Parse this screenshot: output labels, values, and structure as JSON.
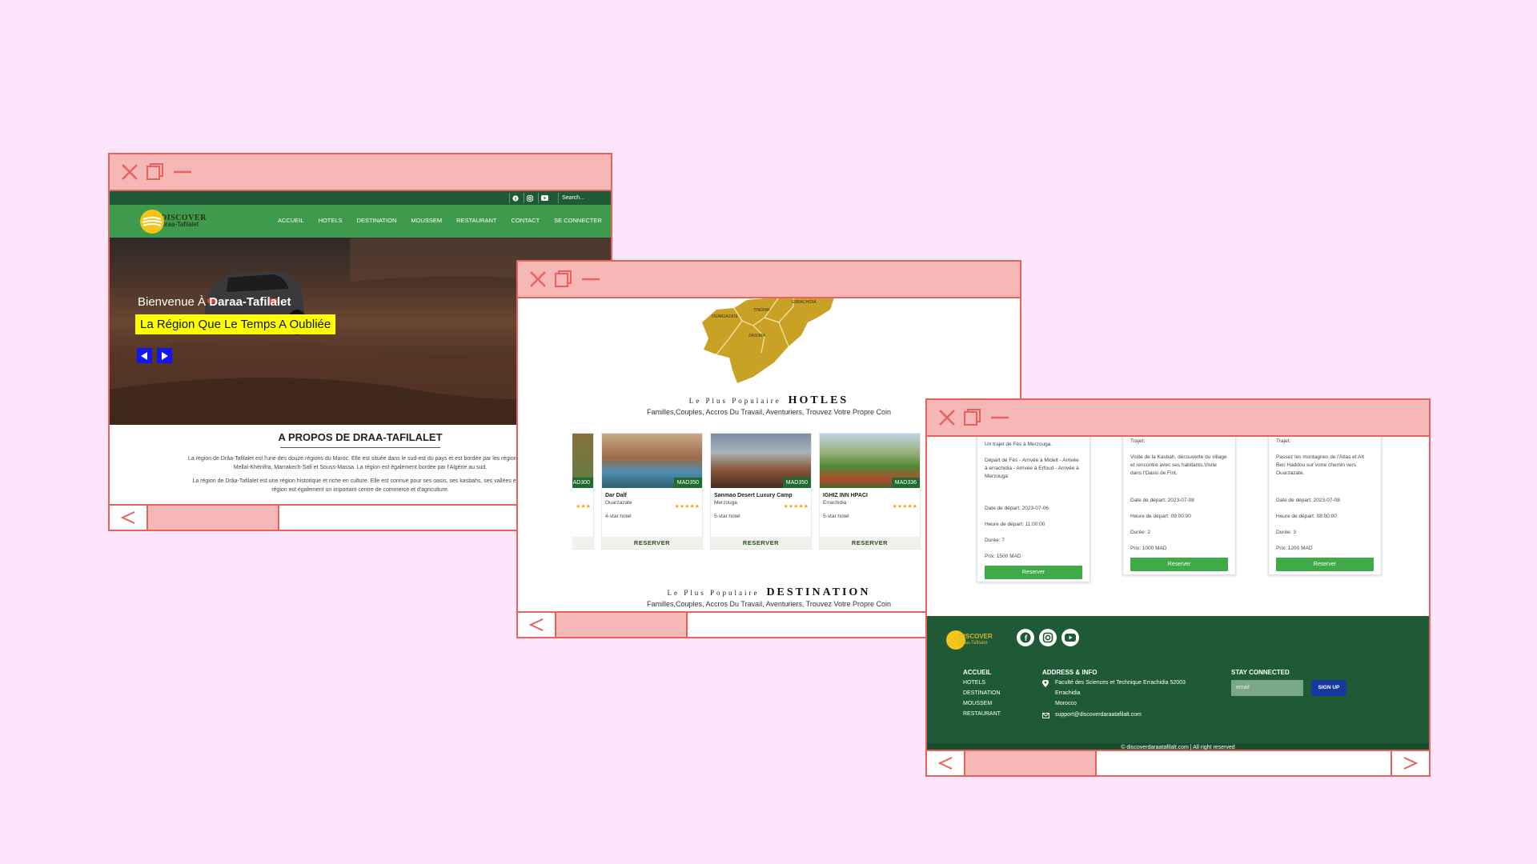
{
  "window1": {
    "search_placeholder": "Search...",
    "logo": {
      "line1": "DISCOVER",
      "line2": "Draa-Tafilalet"
    },
    "nav": [
      "ACCUEIL",
      "HOTELS",
      "DESTINATION",
      "MOUSSEM",
      "RESTAURANT",
      "CONTACT",
      "SE CONNECTER"
    ],
    "hero": {
      "welcome_prefix": "Bienvenue À ",
      "welcome_bold": "Daraa-Tafilalet",
      "tagline": "La Région Que Le Temps A Oubliée"
    },
    "about": {
      "title": "A PROPOS DE DRAA-TAFILALET",
      "p1": "La région de Drâa-Tafilalet est l'une des douze régions du Maroc. Elle est située dans le sud-est du pays et est bordée par les régions Béni Mellal-Khénifra, Marrakech-Safi et Souss-Massa. La région est également bordée par l'Algérie au sud.",
      "p2": "La région de Drâa-Tafilalet est une région historique et riche en culture. Elle est connue pour ses oasis, ses kasbahs, ses vallées et ses région est également un important centre de commerce et d'agriculture."
    }
  },
  "window2": {
    "map_labels": [
      "ERRACHIDIA",
      "OUARZAZATE",
      "TINGHIR",
      "ZAGORA"
    ],
    "hotels_heading": {
      "small": "Le Plus Populaire",
      "big": "HOTLES"
    },
    "hotels_sub": "Familles,Couples, Accros Du Travail, Aventuriers, Trouvez Votre Propre Coin",
    "partial_price": "MAD300",
    "partial_card_stars": "★★★",
    "hotels": [
      {
        "name": "Dar Dalf",
        "location": "Ouarzazate",
        "type": "4-star hotel",
        "price": "MAD350",
        "stars": "★★★★★",
        "button": "RESERVER"
      },
      {
        "name": "Sanmao Desert Luxury Camp",
        "location": "Merzouga",
        "type": "5-star hotel",
        "price": "MAD350",
        "stars": "★★★★★",
        "button": "RESERVER"
      },
      {
        "name": "IGHIZ INN HPACI",
        "location": "Errachidia",
        "type": "5-star hotel",
        "price": "MAD336",
        "stars": "★★★★★",
        "button": "RESERVER"
      }
    ],
    "dest_heading": {
      "small": "Le Plus Populaire",
      "big": "DESTINATION"
    },
    "dest_sub": "Familles,Couples, Accros Du Travail, Aventuriers, Trouvez Votre Propre Coin"
  },
  "window3": {
    "trips": [
      {
        "head": "Un trajet de Fès à Merzouga.",
        "desc": "Départ de Fès - Arrivée à Midelt - Arrivée à errachidia - Arrivée à Erfoud - Arrivée à Merzouga",
        "date": "Date de départ: 2023-07-06",
        "time": "Heure de départ: 11:00:00",
        "duration": "Durée: 7",
        "price": "Prix: 1500 MAD",
        "button": "Reserver"
      },
      {
        "head": "Trajet:",
        "desc": "Visite de la Kasbah, découverte du village et rencontre avec ses habitants.Visite dans l'Oasis de Fint.",
        "date": "Date de départ: 2023-07-08",
        "time": "Heure de départ: 09:00:00",
        "duration": "Durée: 2",
        "price": "Prix: 1000 MAD",
        "button": "Reserver"
      },
      {
        "head": "Trajet:",
        "desc": "Passez les montagnes de l'Atlas et Aït Ben Haddou sur votre chemin vers Ouarzazate.",
        "date": "Date de départ: 2023-07-08",
        "time": "Heure de départ: 08:00:00",
        "duration": "Durée: 3",
        "price": "Prix: 1200 MAD",
        "button": "Reserver"
      }
    ],
    "footer": {
      "logo": {
        "line1": "DISCOVER",
        "line2": "Draa-Tafilalet"
      },
      "col1_title": "ACCUEIL",
      "col1_links": [
        "HOTELS",
        "DESTINATION",
        "MOUSSEM",
        "RESTAURANT"
      ],
      "col2_title": "ADDRESS & INFO",
      "address": [
        "Faculté des Sciences et Technique Errachidia 52003",
        "Errachidia",
        "Morocco"
      ],
      "email_addr": "support@discoverdaraatafilalt.com",
      "col3_title": "STAY CONNECTED",
      "email_placeholder": "email",
      "signup": "SIGN UP",
      "copyright": "© discoverdaraatafilalt.com | All right reserved"
    }
  },
  "colors": {
    "frame": "#e8615d",
    "titlebar": "#f6b8b6",
    "background": "#fde6fb",
    "nav_green": "#3e9a4c",
    "dark_green": "#1f5a36",
    "yellow": "#ffff00",
    "blue": "#1515ee"
  }
}
